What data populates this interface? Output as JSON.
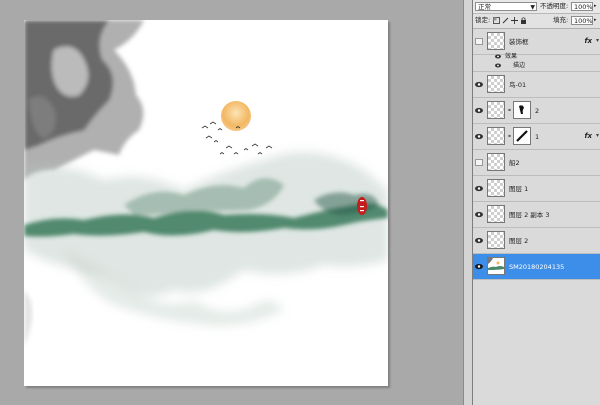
{
  "blend": {
    "mode": "正常",
    "opacity_label": "不透明度:",
    "opacity_value": "100%"
  },
  "lock": {
    "label": "锁定:",
    "fill_label": "填充:",
    "fill_value": "100%"
  },
  "layers": [
    {
      "name": "装饰框",
      "visible": false,
      "fx": "fx",
      "effects_label": "效果",
      "effect_item": "描边"
    },
    {
      "name": "鸟-01",
      "visible": true
    },
    {
      "name": "2",
      "visible": true
    },
    {
      "name": "1",
      "visible": true,
      "fx": "fx"
    },
    {
      "name": "船2",
      "visible": false
    },
    {
      "name": "图层 1",
      "visible": true
    },
    {
      "name": "图层 2 副本 3",
      "visible": true
    },
    {
      "name": "图层 2",
      "visible": true
    },
    {
      "name": "SM20180204135",
      "visible": true,
      "selected": true
    }
  ],
  "colors": {
    "selected": "#3d8ee8",
    "sun": "#f1b25a",
    "ink_green": "#1f6b46",
    "seal": "#c41d1d"
  }
}
